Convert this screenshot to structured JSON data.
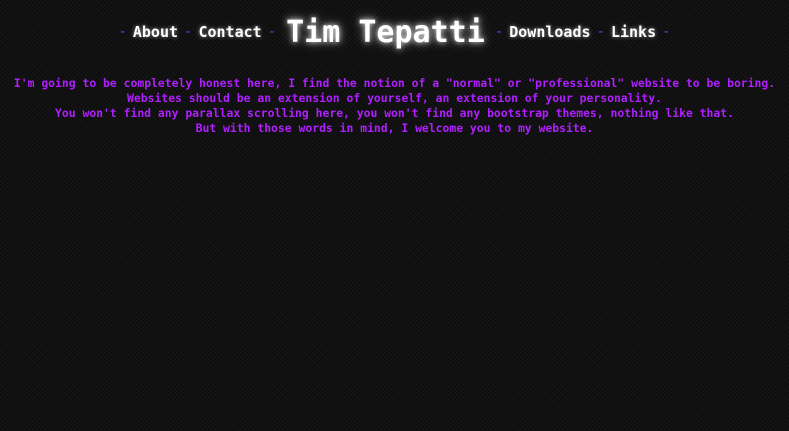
{
  "nav": {
    "separator": "-",
    "about_label": "About",
    "contact_label": "Contact",
    "site_title": "Tim Tepatti",
    "downloads_label": "Downloads",
    "links_label": "Links"
  },
  "intro": {
    "lines": [
      "I'm going to be completely honest here, I find the notion of a \"normal\" or \"professional\" website to be boring.",
      "Websites should be an extension of yourself, an extension of your personality.",
      "You won't find any parallax scrolling here, you won't find any bootstrap themes, nothing like that.",
      "But with those words in mind, I welcome you to my website."
    ]
  },
  "colors": {
    "background": "#111111",
    "nav_text": "#ffffff",
    "separator": "#8a2be2",
    "intro_text": "#b01fff"
  }
}
